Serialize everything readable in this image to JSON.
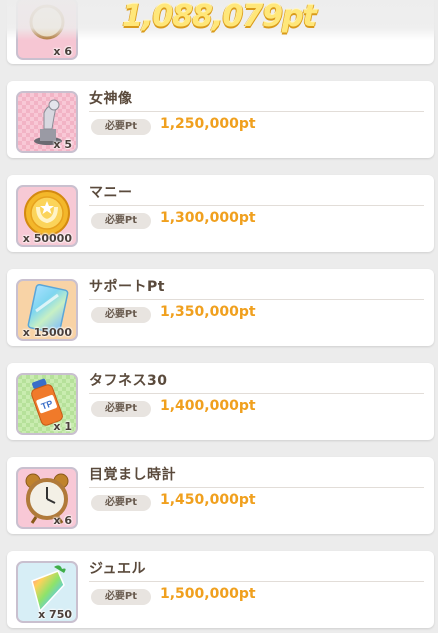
{
  "header": {
    "points": "1,088,079pt"
  },
  "required_label": "必要Pt",
  "partial_item": {
    "qty": "x 6",
    "bg": "#f6c6d3"
  },
  "items": [
    {
      "name": "女神像",
      "qty": "x 5",
      "cost": "1,250,000pt",
      "icon": "goddess-statue-icon",
      "bg": "#f8c8d6"
    },
    {
      "name": "マニー",
      "qty": "x 50000",
      "cost": "1,300,000pt",
      "icon": "money-coin-icon",
      "bg": "#f7c9d5"
    },
    {
      "name": "サポートPt",
      "qty": "x 15000",
      "cost": "1,350,000pt",
      "icon": "support-card-icon",
      "bg": "#f8d3a6"
    },
    {
      "name": "タフネス30",
      "qty": "x 1",
      "cost": "1,400,000pt",
      "icon": "energy-drink-icon",
      "bg": "#c9ecb0"
    },
    {
      "name": "目覚まし時計",
      "qty": "x 6",
      "cost": "1,450,000pt",
      "icon": "alarm-clock-icon",
      "bg": "#f8c8d6"
    },
    {
      "name": "ジュエル",
      "qty": "x 750",
      "cost": "1,500,000pt",
      "icon": "jewel-icon",
      "bg": "#d7eef6"
    }
  ]
}
